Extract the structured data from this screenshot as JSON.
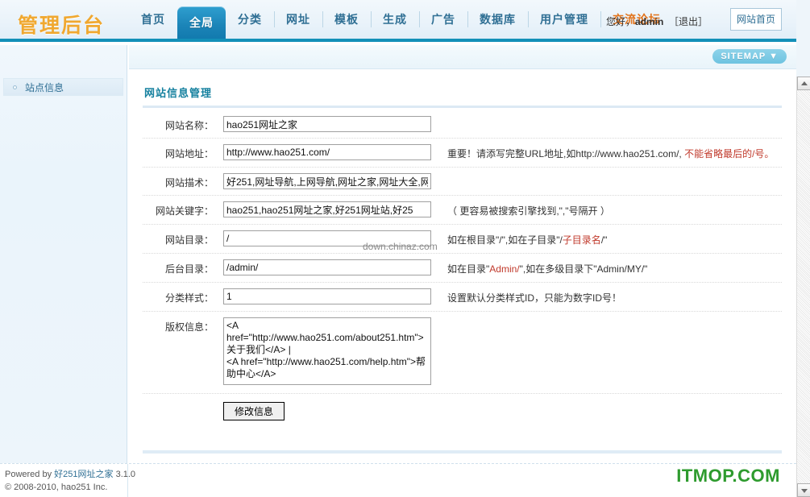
{
  "header": {
    "logo": "管理后台",
    "nav": [
      {
        "label": "首页",
        "active": false,
        "highlight": false
      },
      {
        "label": "全局",
        "active": true,
        "highlight": false
      },
      {
        "label": "分类",
        "active": false,
        "highlight": false
      },
      {
        "label": "网址",
        "active": false,
        "highlight": false
      },
      {
        "label": "模板",
        "active": false,
        "highlight": false
      },
      {
        "label": "生成",
        "active": false,
        "highlight": false
      },
      {
        "label": "广告",
        "active": false,
        "highlight": false
      },
      {
        "label": "数据库",
        "active": false,
        "highlight": false
      },
      {
        "label": "用户管理",
        "active": false,
        "highlight": false
      },
      {
        "label": "交流论坛",
        "active": false,
        "highlight": true
      }
    ],
    "greeting": "您好，",
    "username": "admin",
    "logout": "［退出］",
    "site_home_button": "网站首页"
  },
  "sitemap": {
    "button_label": "SITEMAP",
    "button_icon": "download-arrow-icon"
  },
  "sidebar": {
    "items": [
      {
        "label": "站点信息",
        "icon": "circle-bullet-icon"
      }
    ]
  },
  "main": {
    "panel_title": "网站信息管理",
    "watermark": "down.chinaz.com",
    "fields": [
      {
        "label": "网站名称：",
        "name": "site-name",
        "type": "text",
        "value": "hao251网址之家",
        "hint": "",
        "hint_red": "",
        "hint_tail": ""
      },
      {
        "label": "网站地址：",
        "name": "site-url",
        "type": "text",
        "value": "http://www.hao251.com/",
        "hint": "重要！请添写完整URL地址,如http://www.hao251.com/, ",
        "hint_red": "不能省略最后的/号。",
        "hint_tail": ""
      },
      {
        "label": "网站描术：",
        "name": "site-description",
        "type": "text",
        "value": "好251,网址导航,上网导航,网址之家,网址大全,网",
        "hint": "",
        "hint_red": "",
        "hint_tail": ""
      },
      {
        "label": "网站关键字：",
        "name": "site-keywords",
        "type": "text",
        "value": "hao251,hao251网址之家,好251网址站,好25",
        "hint": "（ 更容易被搜索引擎找到,\",\"号隔开 ）",
        "hint_red": "",
        "hint_tail": ""
      },
      {
        "label": "网站目录：",
        "name": "site-directory",
        "type": "text",
        "value": "/",
        "hint": "如在根目录\"/\",如在子目录\"/",
        "hint_red": "子目录名",
        "hint_tail": "/\""
      },
      {
        "label": "后台目录：",
        "name": "admin-directory",
        "type": "text",
        "value": "/admin/",
        "hint": "如在目录\"",
        "hint_red": "Admin/",
        "hint_tail": "\",如在多级目录下\"Admin/MY/\""
      },
      {
        "label": "分类样式：",
        "name": "category-style",
        "type": "text",
        "value": "1",
        "hint": "设置默认分类样式ID，只能为数字ID号！",
        "hint_red": "",
        "hint_tail": ""
      },
      {
        "label": "版权信息：",
        "name": "copyright-info",
        "type": "textarea",
        "value": "<A href=\"http://www.hao251.com/about251.htm\">关于我们</A> |\n<A href=\"http://www.hao251.com/help.htm\">帮助中心</A>",
        "hint": "",
        "hint_red": "",
        "hint_tail": ""
      }
    ],
    "submit_label": "修改信息"
  },
  "footer": {
    "powered_prefix": "Powered by ",
    "powered_brand": "好251网址之家",
    "version": " 3.1.0",
    "copyright": "© 2008-2010, hao251 Inc.",
    "brand_mark": "ITMOP.COM"
  },
  "colors": {
    "accent_blue": "#1390b8",
    "tab_active": "#1b84b8",
    "logo_orange": "#f0a830",
    "highlight_orange": "#e2741c",
    "hint_red": "#c0392b",
    "brand_green": "#2e9b2e"
  }
}
